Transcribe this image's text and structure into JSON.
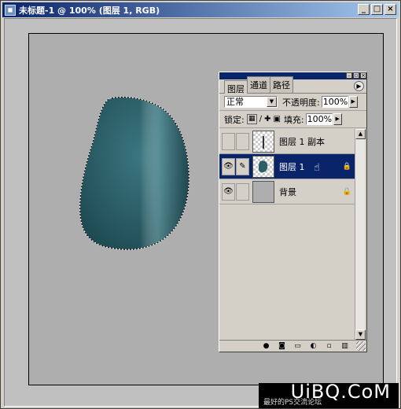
{
  "window": {
    "title": "未标题-1 @ 100% (图层 1, RGB)",
    "buttons": {
      "minimize": "_",
      "maximize": "□",
      "close": "×"
    }
  },
  "canvas": {
    "shape_color": "#2c5f68",
    "background_color": "#aeaeae"
  },
  "watermark": {
    "logo": "UiBQ.CoM",
    "subtitle": "最好的PS交流论坛"
  },
  "layers_panel": {
    "tabs": [
      "图层",
      "通道",
      "路径"
    ],
    "active_tab": 0,
    "blend_mode": "正常",
    "opacity_label": "不透明度:",
    "opacity_value": "100%",
    "lock_label": "锁定:",
    "fill_label": "填充:",
    "fill_value": "100%",
    "layers": [
      {
        "name": "图层 1 副本",
        "visible": false,
        "selected": false,
        "thumb": "text-cursor"
      },
      {
        "name": "图层 1",
        "visible": true,
        "selected": true,
        "thumb": "blob"
      },
      {
        "name": "背景",
        "visible": true,
        "selected": false,
        "thumb": "grey"
      }
    ],
    "bottom_icons": [
      "link-icon",
      "layer-style-icon",
      "mask-icon",
      "folder-icon",
      "adjustment-icon",
      "new-layer-icon",
      "trash-icon"
    ]
  }
}
